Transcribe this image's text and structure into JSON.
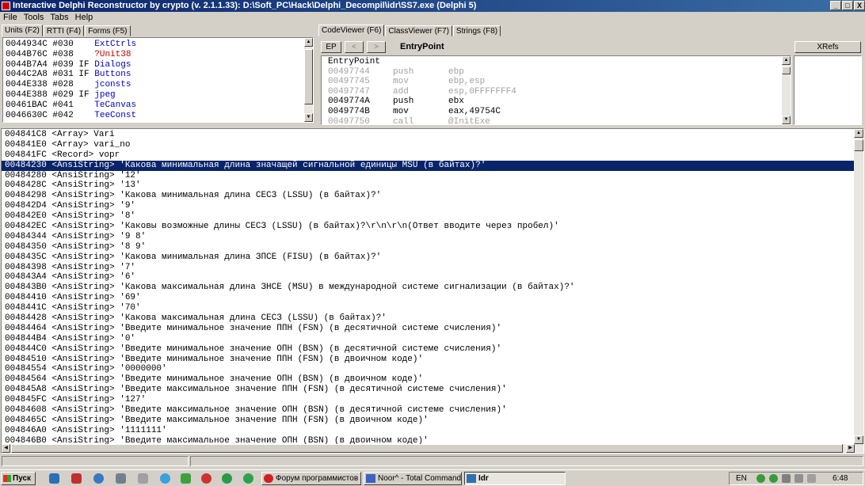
{
  "window": {
    "title": "Interactive Delphi Reconstructor by crypto (v. 2.1.1.33): D:\\Soft_PC\\Hack\\Delphi_Decompil\\idr\\SS7.exe (Delphi 5)",
    "minimize": "_",
    "maximize": "□",
    "close": "X"
  },
  "menu": [
    "File",
    "Tools",
    "Tabs",
    "Help"
  ],
  "left_tabs": [
    "Units (F2)",
    "RTTI (F4)",
    "Forms (F5)"
  ],
  "right_tabs": [
    "CodeViewer (F6)",
    "ClassViewer (F7)",
    "Strings (F8)"
  ],
  "units": [
    {
      "addr": "0044934C #030",
      "flag": "   ",
      "name": "ExtCtrls",
      "red": false
    },
    {
      "addr": "0044B76C #038",
      "flag": "   ",
      "name": "?Unit38",
      "red": true
    },
    {
      "addr": "0044B7A4 #039",
      "flag": " IF",
      "name": "Dialogs",
      "red": false
    },
    {
      "addr": "0044C2A8 #031",
      "flag": " IF",
      "name": "Buttons",
      "red": false
    },
    {
      "addr": "0044E338 #028",
      "flag": "   ",
      "name": "jconsts",
      "red": false
    },
    {
      "addr": "0044E388 #029",
      "flag": " IF",
      "name": "jpeg",
      "red": false
    },
    {
      "addr": "00461BAC #041",
      "flag": "   ",
      "name": "TeCanvas",
      "red": false
    },
    {
      "addr": "0046630C #042",
      "flag": "   ",
      "name": "TeeConst",
      "red": false
    }
  ],
  "codeviewer": {
    "ep_label": "EP",
    "back_label": "<",
    "forward_label": ">",
    "entry_label": "EntryPoint",
    "xrefs_label": "XRefs",
    "header": "EntryPoint",
    "lines": [
      {
        "addr": "00497744",
        "op": "push",
        "arg": "ebp",
        "gray": true
      },
      {
        "addr": "00497745",
        "op": "mov",
        "arg": "ebp,esp",
        "gray": true
      },
      {
        "addr": "00497747",
        "op": "add",
        "arg": "esp,0FFFFFFF4",
        "gray": true
      },
      {
        "addr": "0049774A",
        "op": "push",
        "arg": "ebx",
        "gray": false
      },
      {
        "addr": "0049774B",
        "op": "mov",
        "arg": "eax,49754C",
        "gray": false
      },
      {
        "addr": "00497750",
        "op": "call",
        "arg": "@InitExe",
        "gray": true
      }
    ]
  },
  "strings": [
    "004841C8 <Array> Vari",
    "004841E0 <Array> vari_no",
    "004841FC <Record> vopr",
    "00484230 <AnsiString> 'Какова минимальная длина значащей сигнальной единицы MSU (в байтах)?'",
    "00484280 <AnsiString> '12'",
    "0048428C <AnsiString> '13'",
    "00484298 <AnsiString> 'Какова минимальная длина СЕСЗ (LSSU) (в байтах)?'",
    "004842D4 <AnsiString> '9'",
    "004842E0 <AnsiString> '8'",
    "004842EC <AnsiString> 'Каковы возможные длины СЕСЗ (LSSU) (в байтах)?\\r\\n\\r\\n(Ответ вводите через пробел)'",
    "00484344 <AnsiString> '9 8'",
    "00484350 <AnsiString> '8 9'",
    "0048435C <AnsiString> 'Какова минимальная длина ЗПСЕ (FISU) (в байтах)?'",
    "00484398 <AnsiString> '7'",
    "004843A4 <AnsiString> '6'",
    "004843B0 <AnsiString> 'Какова максимальная длина ЗНСЕ (MSU) в международной системе сигнализации (в байтах)?'",
    "00484410 <AnsiString> '69'",
    "0048441C <AnsiString> '70'",
    "00484428 <AnsiString> 'Какова максимальная длина СЕСЗ (LSSU) (в байтах)?'",
    "00484464 <AnsiString> 'Введите минимальное значение ППН (FSN) (в десятичной системе счисления)'",
    "004844B4 <AnsiString> '0'",
    "004844C0 <AnsiString> 'Введите минимальное значение ОПН (BSN) (в десятичной системе счисления)'",
    "00484510 <AnsiString> 'Введите минимальное значение ППН (FSN) (в двоичном коде)'",
    "00484554 <AnsiString> '0000000'",
    "00484564 <AnsiString> 'Введите минимальное значение ОПН (BSN) (в двоичном коде)'",
    "004845A8 <AnsiString> 'Введите максимальное значение ППН (FSN) (в десятичной системе счисления)'",
    "004845FC <AnsiString> '127'",
    "00484608 <AnsiString> 'Введите максимальное значение ОПН (BSN) (в десятичной системе счисления)'",
    "0048465C <AnsiString> 'Введите максимальное значение ППН (FSN) (в двоичном коде)'",
    "004846A0 <AnsiString> '1111111'",
    "004846B0 <AnsiString> 'Введите максимальное значение ОПН (BSN) (в двоичном коде)'"
  ],
  "selected_index": 3,
  "taskbar": {
    "start": "Пуск",
    "tasks": [
      {
        "label": "Форум программистов -...",
        "active": false
      },
      {
        "label": "Noor^ - Total Command...",
        "active": false
      },
      {
        "label": "Idr",
        "active": true
      }
    ],
    "lang": "EN",
    "clock": "6:48"
  },
  "colors": {
    "selection": "#0a246a",
    "unit_name": "#0000c0",
    "unit_red": "#c00000"
  }
}
